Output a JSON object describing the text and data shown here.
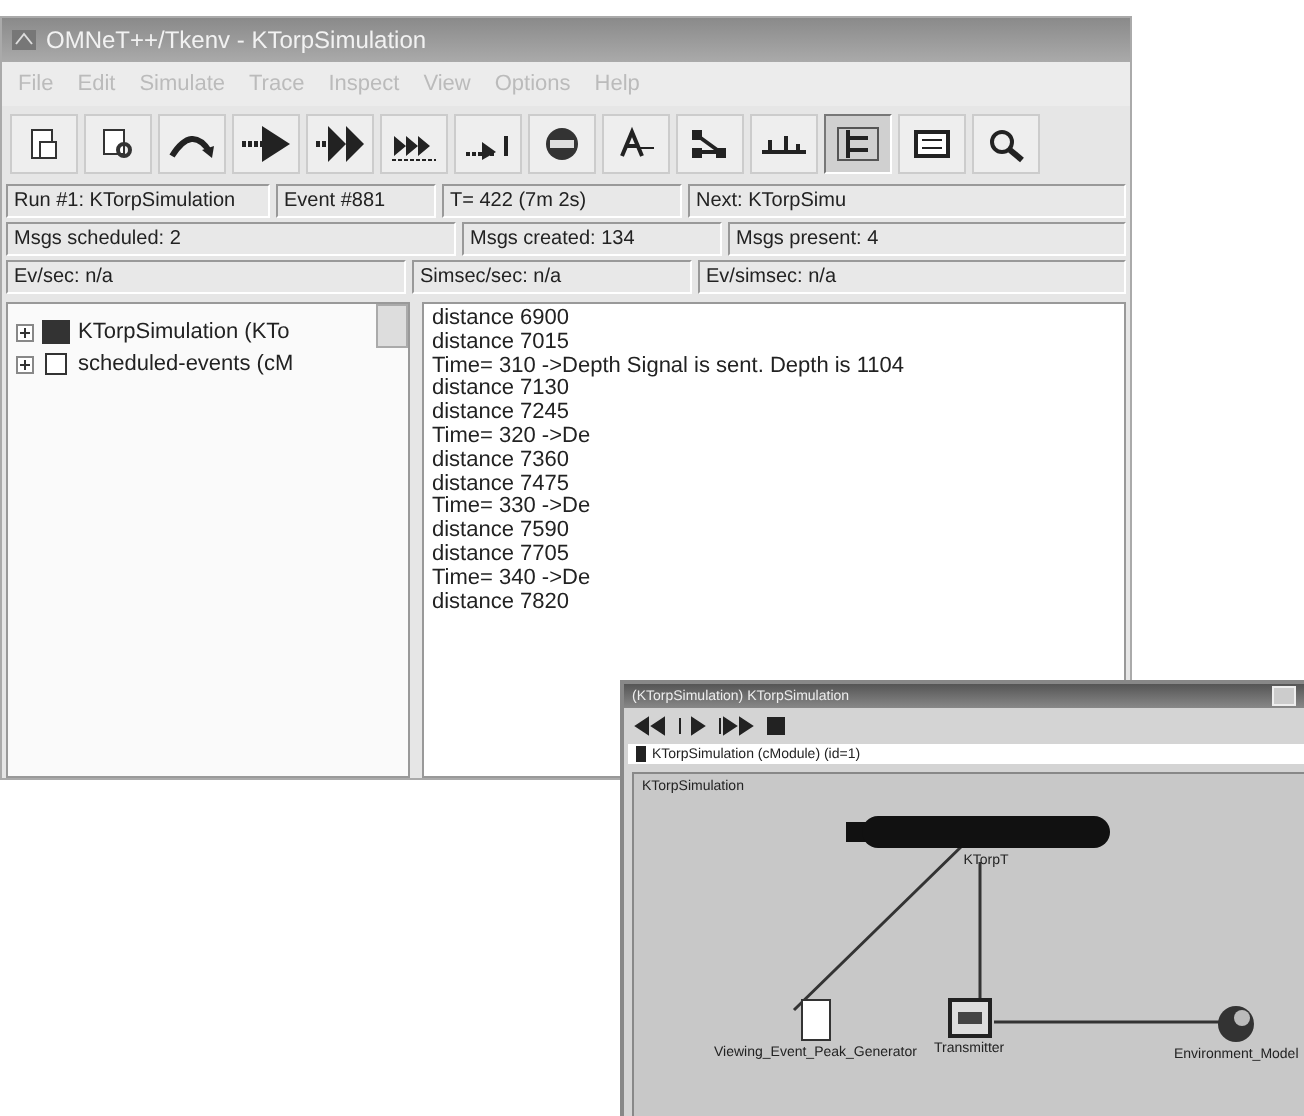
{
  "main_window": {
    "title": "OMNeT++/Tkenv - KTorpSimulation",
    "menu": [
      "File",
      "Edit",
      "Simulate",
      "Trace",
      "Inspect",
      "View",
      "Options",
      "Help"
    ],
    "toolbar": [
      {
        "kind": "page",
        "pressed": false
      },
      {
        "kind": "inspect",
        "pressed": false
      },
      {
        "kind": "step",
        "pressed": false
      },
      {
        "kind": "run",
        "pressed": false
      },
      {
        "kind": "fast",
        "pressed": false
      },
      {
        "kind": "express",
        "pressed": false
      },
      {
        "kind": "until",
        "pressed": false
      },
      {
        "kind": "stop",
        "pressed": false
      },
      {
        "kind": "text",
        "pressed": false
      },
      {
        "kind": "network",
        "pressed": false
      },
      {
        "kind": "timeline",
        "pressed": false
      },
      {
        "kind": "tree",
        "pressed": true
      },
      {
        "kind": "list",
        "pressed": false
      },
      {
        "kind": "search",
        "pressed": false
      }
    ],
    "status_rows": [
      [
        "Run #1: KTorpSimulation",
        "Event #881",
        "T=   422 (7m 2s)",
        "Next: KTorpSimu"
      ],
      [
        "Msgs scheduled: 2",
        "Msgs created: 134",
        "Msgs present: 4"
      ],
      [
        "Ev/sec: n/a",
        "Simsec/sec: n/a",
        "Ev/simsec: n/a"
      ]
    ],
    "tree": [
      {
        "label": "KTorpSimulation (KTo",
        "kind": "module"
      },
      {
        "label": "scheduled-events (cM",
        "kind": "queue"
      }
    ],
    "log": [
      "distance 6900",
      "distance 7015",
      "Time= 310 ->Depth Signal is sent. Depth is 1104",
      "distance 7130",
      "distance 7245",
      "Time= 320 ->De",
      "distance 7360",
      "distance 7475",
      "Time= 330 ->De",
      "distance 7590",
      "distance 7705",
      "Time= 340 ->De",
      "distance 7820"
    ]
  },
  "inspector_window": {
    "title": "(KTorpSimulation) KTorpSimulation",
    "path": "KTorpSimulation (cModule) (id=1)",
    "canvas_label": "KTorpSimulation",
    "nodes": [
      {
        "label": "KTorpT",
        "kind": "torpedo"
      },
      {
        "label": "Viewing_Event_Peak_Generator",
        "kind": "file"
      },
      {
        "label": "Transmitter",
        "kind": "box"
      },
      {
        "label": "Environment_Model",
        "kind": "sphere"
      }
    ]
  }
}
